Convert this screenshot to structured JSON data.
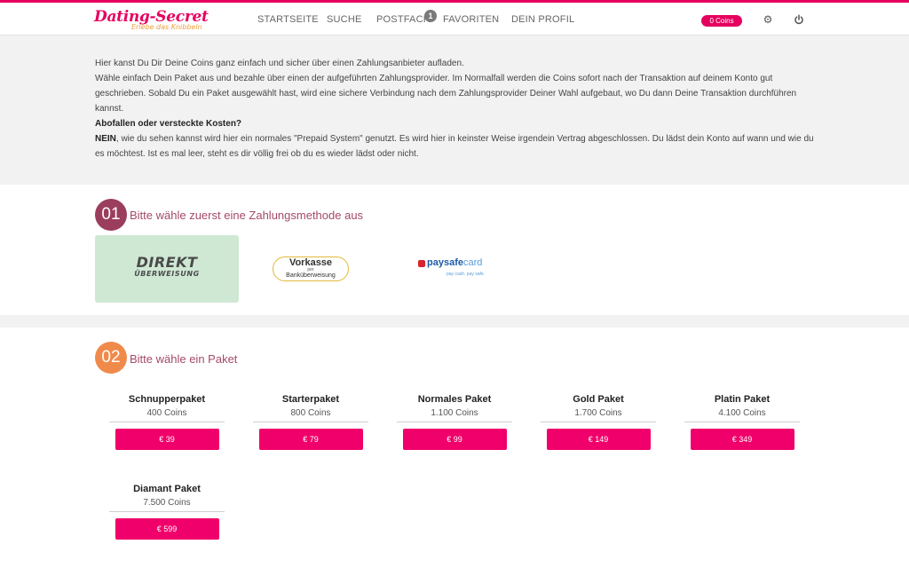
{
  "header": {
    "logo": {
      "name": "Dating-Secret",
      "tagline": "Erlebe das Knibbeln"
    },
    "nav": [
      {
        "label": "STARTSEITE"
      },
      {
        "label": "SUCHE"
      },
      {
        "label": "POSTFACH",
        "badge": "1"
      },
      {
        "label": "FAVORITEN"
      },
      {
        "label": "DEIN PROFIL"
      }
    ],
    "coins": "0 Coins",
    "icons": [
      "gear-icon",
      "power-icon"
    ]
  },
  "intro": {
    "p1": "Hier kanst Du Dir Deine Coins ganz einfach und sicher über einen Zahlungsanbieter aufladen.",
    "p2": "Wähle einfach Dein Paket aus und bezahle über einen der aufgeführten Zahlungsprovider. Im Normalfall werden die Coins sofort nach der Transaktion auf deinem Konto gut geschrieben. Sobald Du ein Paket ausgewählt hast, wird eine sichere Verbindung nach dem Zahlungsprovider Deiner Wahl aufgebaut, wo Du dann Deine Transaktion durchführen kannst.",
    "q": "Abofallen oder versteckte Kosten?",
    "a_bold": "NEIN",
    "a_rest": ", wie du sehen kannst wird hier ein normales \"Prepaid System\" genutzt. Es wird hier in keinster Weise irgendein Vertrag abgeschlossen. Du lädst dein Konto auf wann und wie du es möchtest. Ist es mal leer, steht es dir völlig frei ob du es wieder lädst oder nicht."
  },
  "step1": {
    "number": "01",
    "title": "Bitte wähle zuerst eine Zahlungsmethode aus",
    "methods": [
      {
        "line1": "DIREKT",
        "line2": "ÜBERWEISUNG",
        "selected": true
      },
      {
        "line1": "Vorkasse",
        "small": "per",
        "line2": "Banküberweisung",
        "selected": false
      },
      {
        "brand1": "paysafe",
        "brand2": "card",
        "slogan": "pay cash. pay safe.",
        "selected": false
      }
    ]
  },
  "step2": {
    "number": "02",
    "title": "Bitte wähle ein Paket",
    "packages": [
      {
        "name": "Schnupperpaket",
        "coins": "400 Coins",
        "price": "€ 39"
      },
      {
        "name": "Starterpaket",
        "coins": "800 Coins",
        "price": "€ 79"
      },
      {
        "name": "Normales Paket",
        "coins": "1.100 Coins",
        "price": "€ 99"
      },
      {
        "name": "Gold Paket",
        "coins": "1.700 Coins",
        "price": "€ 149"
      },
      {
        "name": "Platin Paket",
        "coins": "4.100 Coins",
        "price": "€ 349"
      },
      {
        "name": "Diamant Paket",
        "coins": "7.500 Coins",
        "price": "€ 599"
      }
    ]
  },
  "colors": {
    "accent": "#e5005f",
    "step1": "#9b3d5c",
    "step2": "#f08a4b",
    "selected_bg": "#cfe8d4"
  }
}
